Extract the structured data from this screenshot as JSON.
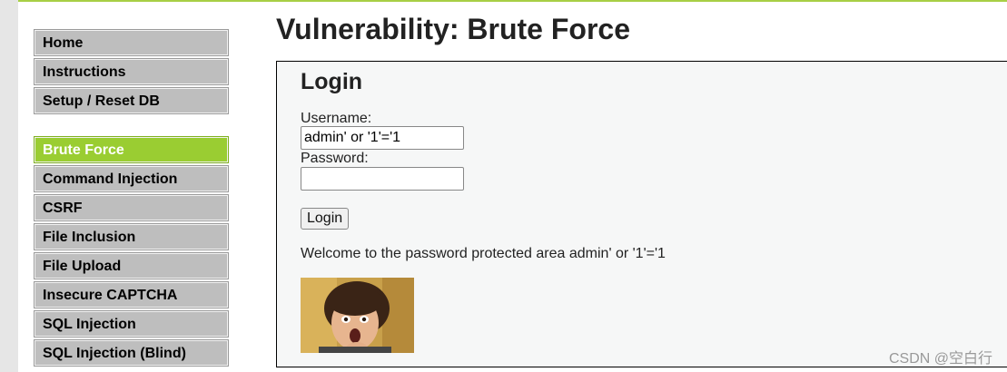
{
  "menu": {
    "group1": [
      {
        "label": "Home"
      },
      {
        "label": "Instructions"
      },
      {
        "label": "Setup / Reset DB"
      }
    ],
    "group2": [
      {
        "label": "Brute Force",
        "active": true
      },
      {
        "label": "Command Injection"
      },
      {
        "label": "CSRF"
      },
      {
        "label": "File Inclusion"
      },
      {
        "label": "File Upload"
      },
      {
        "label": "Insecure CAPTCHA"
      },
      {
        "label": "SQL Injection"
      },
      {
        "label": "SQL Injection (Blind)"
      }
    ]
  },
  "page": {
    "title": "Vulnerability: Brute Force"
  },
  "login": {
    "heading": "Login",
    "username_label": "Username:",
    "username_value": "admin' or '1'='1",
    "password_label": "Password:",
    "password_value": "",
    "button_label": "Login",
    "welcome_message": "Welcome to the password protected area admin' or '1'='1"
  },
  "watermark": "CSDN @空白行",
  "colors": {
    "accent": "#9acd32",
    "menu_bg": "#bebebe"
  }
}
